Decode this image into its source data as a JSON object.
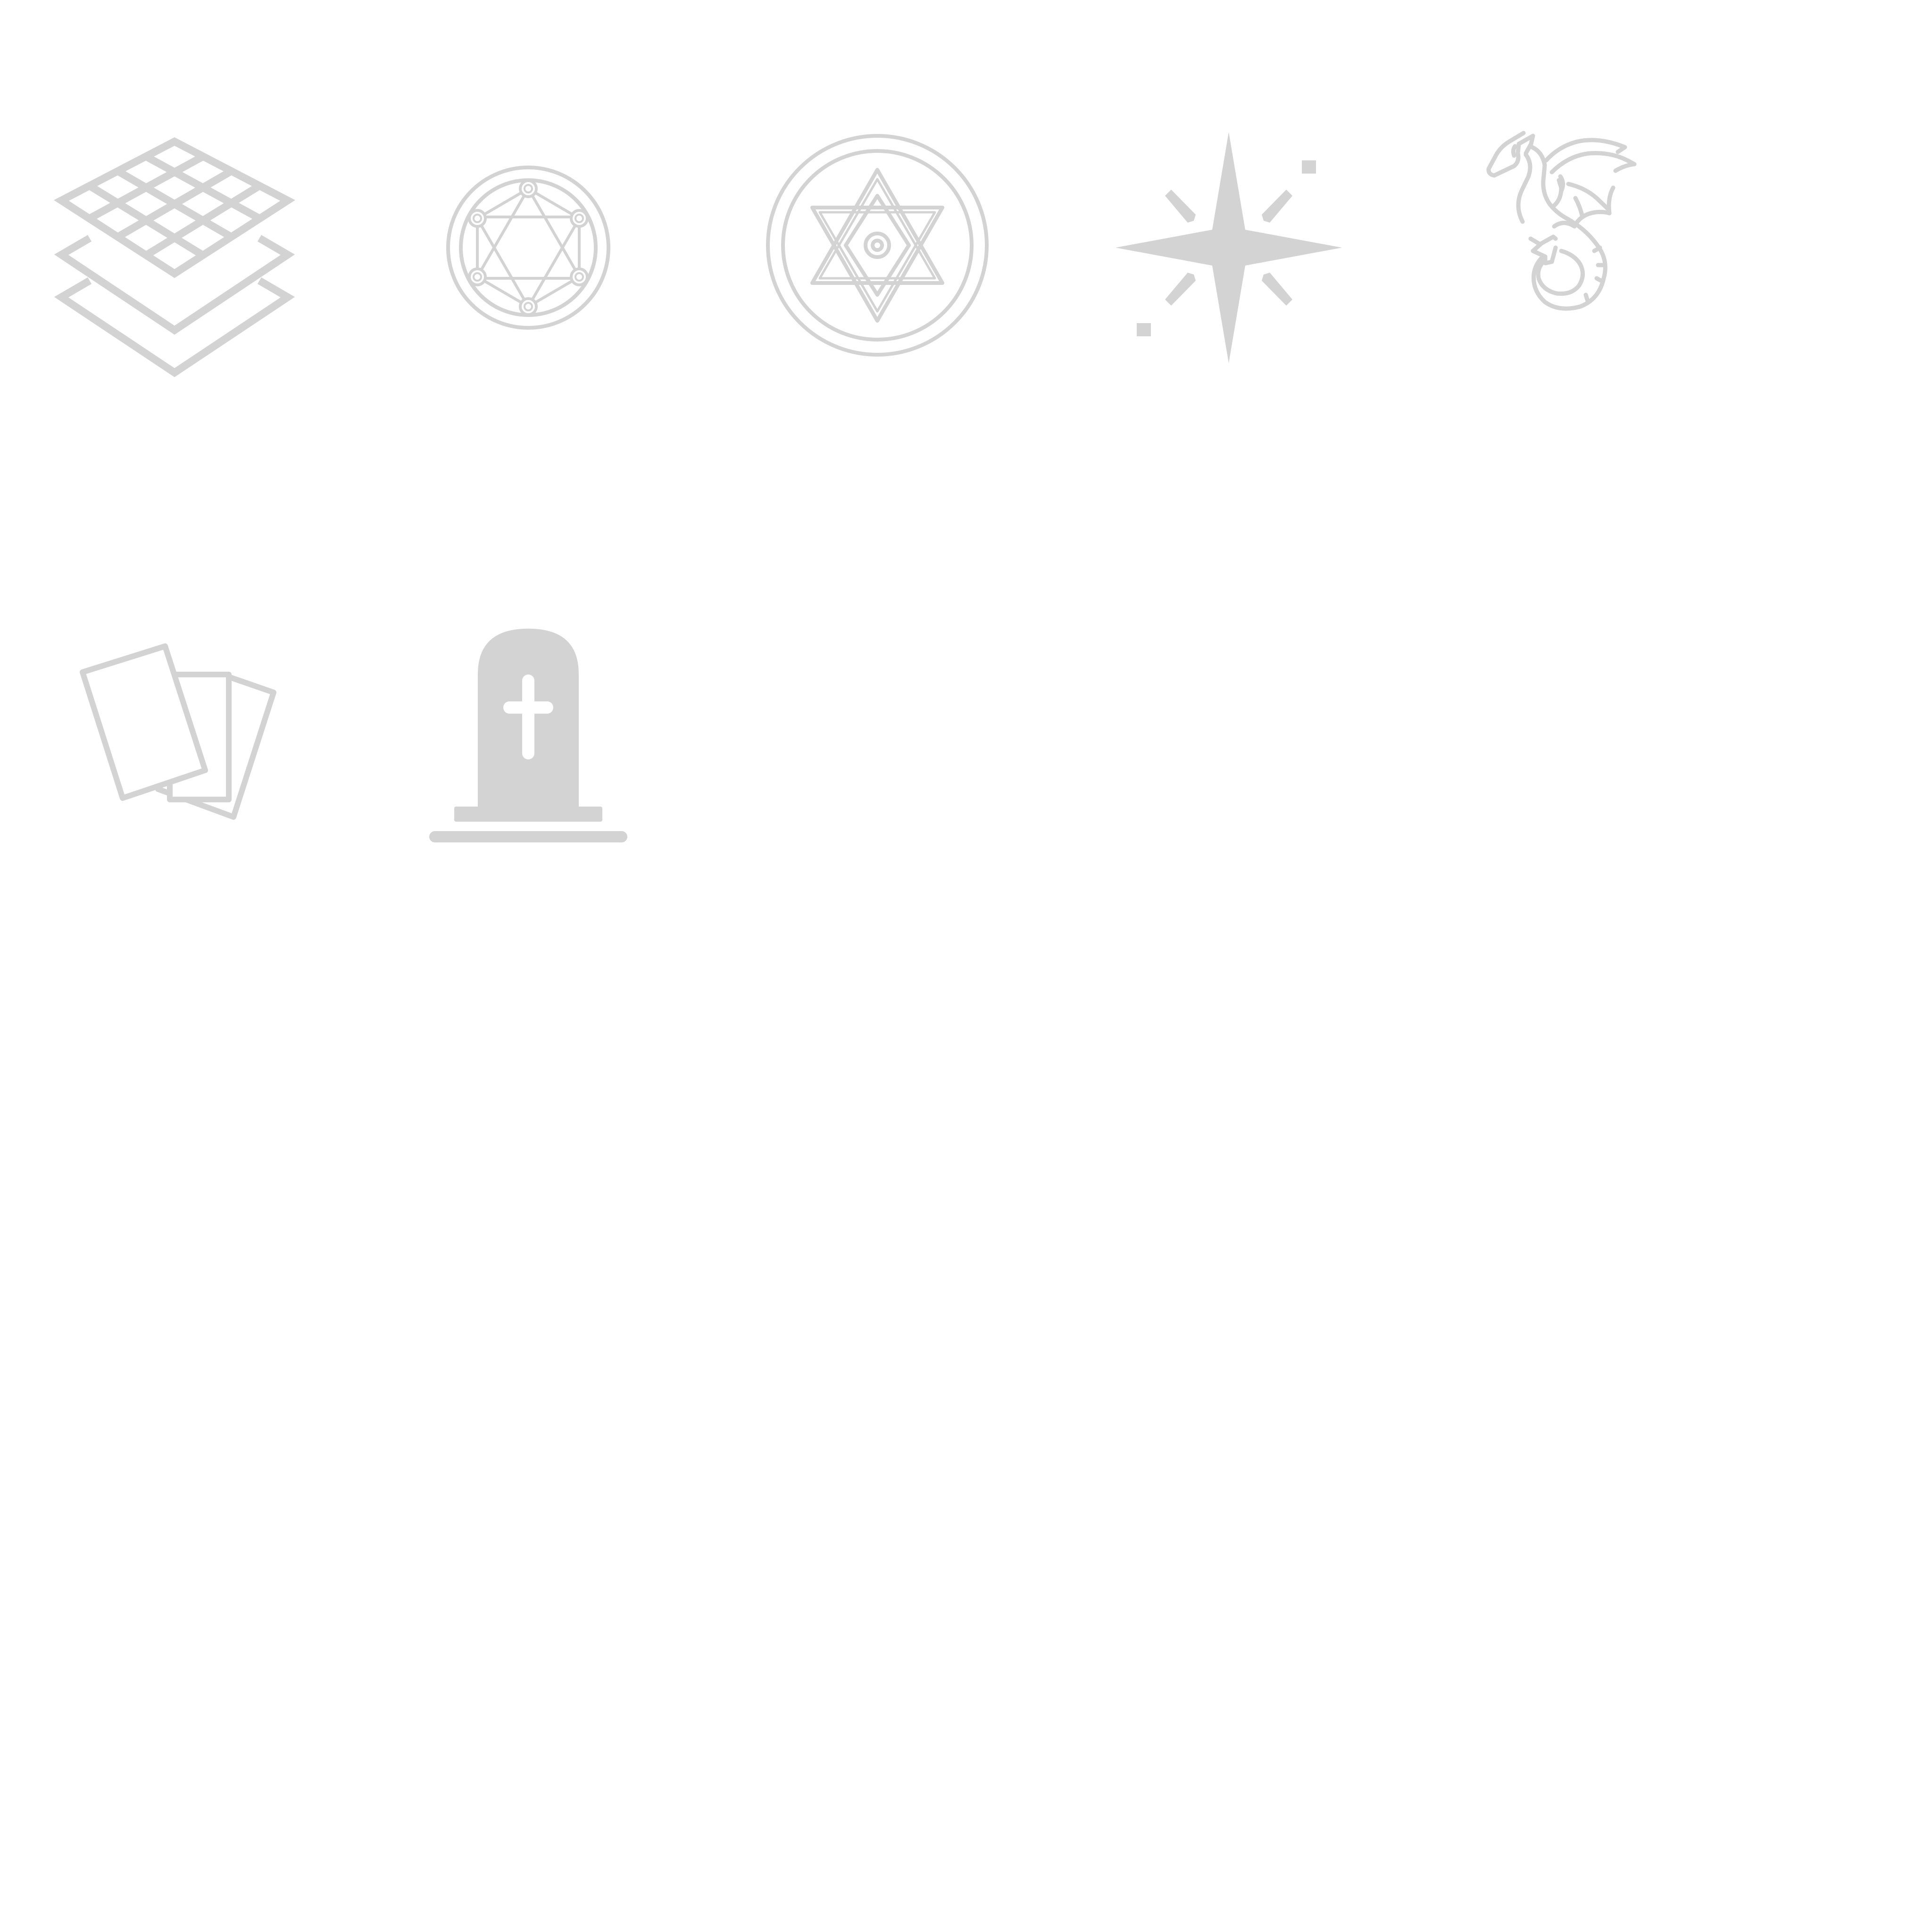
{
  "colors": {
    "background": "#ffffff",
    "icon": "#d3d3d3"
  },
  "icons": [
    {
      "id": "i-layers",
      "name": "stacked-grid-layers-icon"
    },
    {
      "id": "i-circle",
      "name": "magic-circle-icon"
    },
    {
      "id": "i-hexagram",
      "name": "hexagram-seal-icon"
    },
    {
      "id": "i-sparkle",
      "name": "four-point-star-sparkle-icon"
    },
    {
      "id": "i-dragon",
      "name": "dragon-icon"
    },
    {
      "id": "i-cards",
      "name": "tarot-cards-icon"
    },
    {
      "id": "i-grave",
      "name": "tombstone-icon"
    }
  ]
}
